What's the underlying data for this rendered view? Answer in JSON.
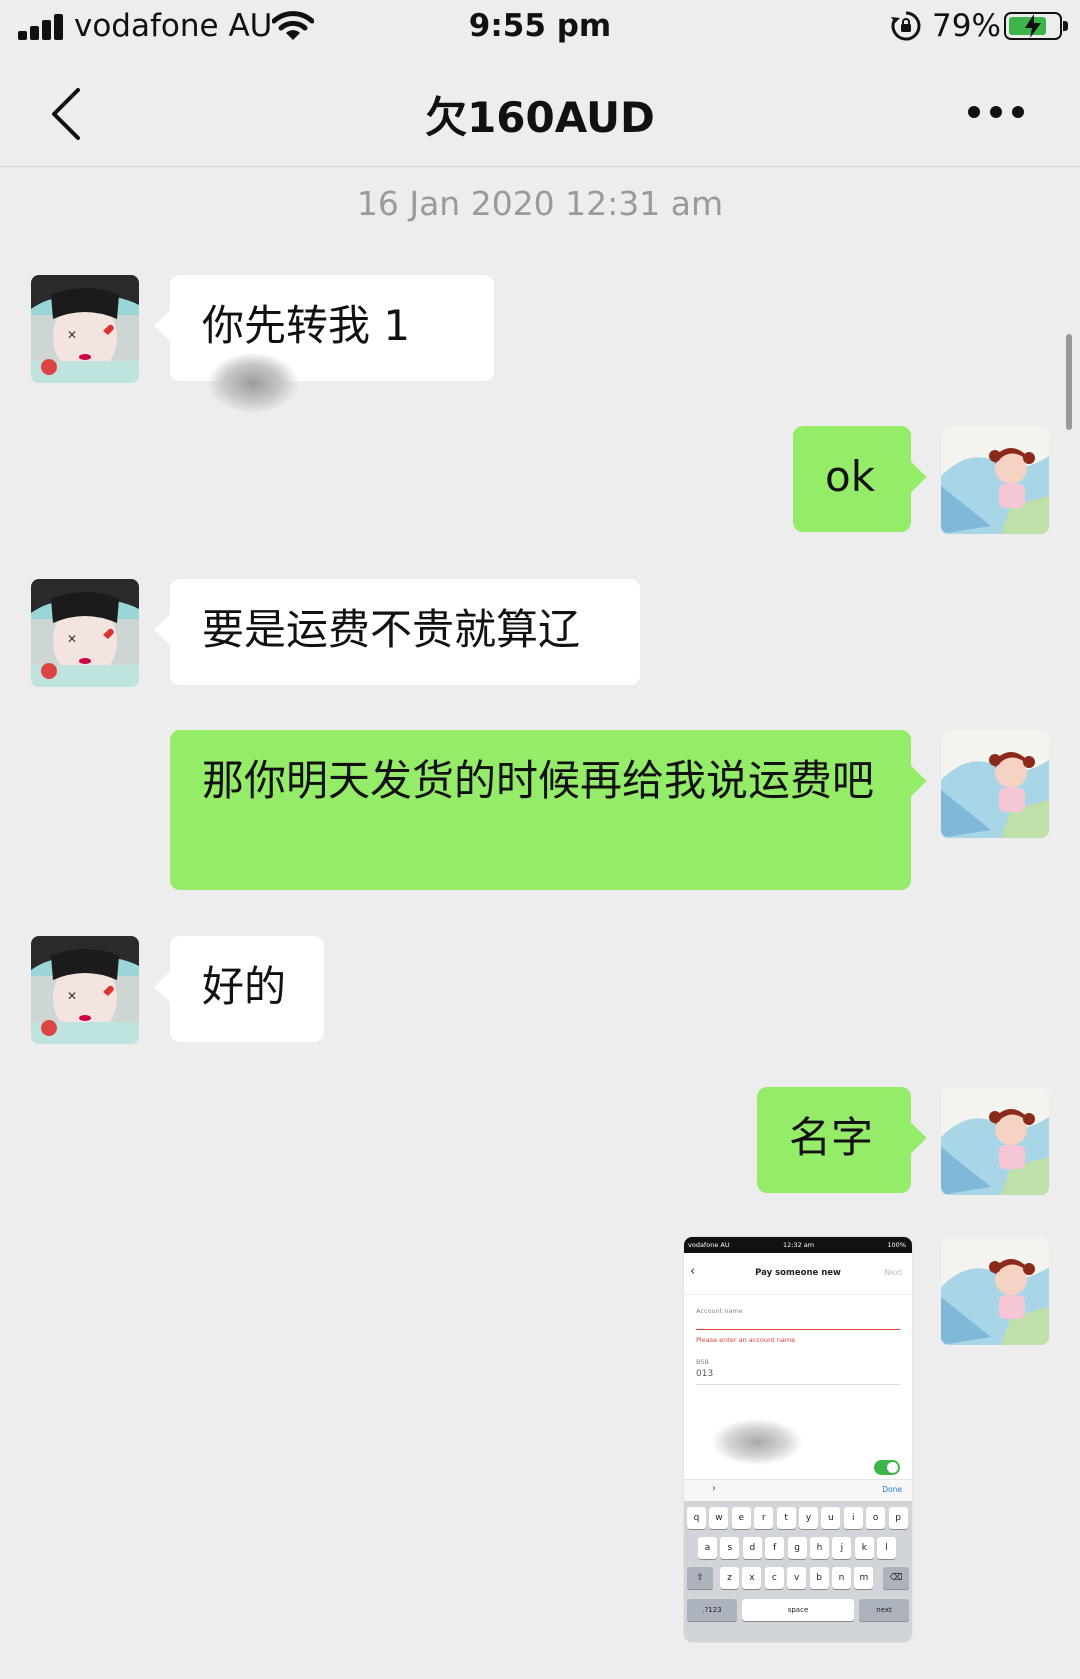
{
  "status_bar": {
    "carrier": "vodafone AU",
    "time": "9:55 pm",
    "battery_percent": "79%",
    "battery_level": 0.79
  },
  "nav": {
    "title": "欠160AUD"
  },
  "timestamp": "16 Jan 2020 12:31 am",
  "messages": [
    {
      "side": "in",
      "text": "你先转我 1"
    },
    {
      "side": "out",
      "text": "ok"
    },
    {
      "side": "in",
      "text": "要是运费不贵就算辽"
    },
    {
      "side": "out",
      "text": "那你明天发货的时候再给我说运费吧"
    },
    {
      "side": "in",
      "text": "好的"
    },
    {
      "side": "out",
      "text": "名字"
    },
    {
      "side": "out",
      "type": "image",
      "text": ""
    }
  ],
  "screenshot": {
    "carrier": "vodafone AU",
    "time": "12:32 am",
    "battery": "100%",
    "title": "Pay someone new",
    "next": "Next",
    "account_name_label": "Account name",
    "error": "Please enter an account name",
    "bsb_label": "BSB",
    "bsb_value": "013",
    "done": "Done",
    "keys_row1": [
      "q",
      "w",
      "e",
      "r",
      "t",
      "y",
      "u",
      "i",
      "o",
      "p"
    ],
    "keys_row2": [
      "a",
      "s",
      "d",
      "f",
      "g",
      "h",
      "j",
      "k",
      "l"
    ],
    "keys_row3": [
      "z",
      "x",
      "c",
      "v",
      "b",
      "n",
      "m"
    ],
    "key_numbers": ".?123",
    "key_space": "space",
    "key_next": "next"
  },
  "colors": {
    "background": "#ededed",
    "incoming_bubble": "#ffffff",
    "outgoing_bubble": "#95ec69",
    "timestamp_text": "#9a9a9a"
  }
}
